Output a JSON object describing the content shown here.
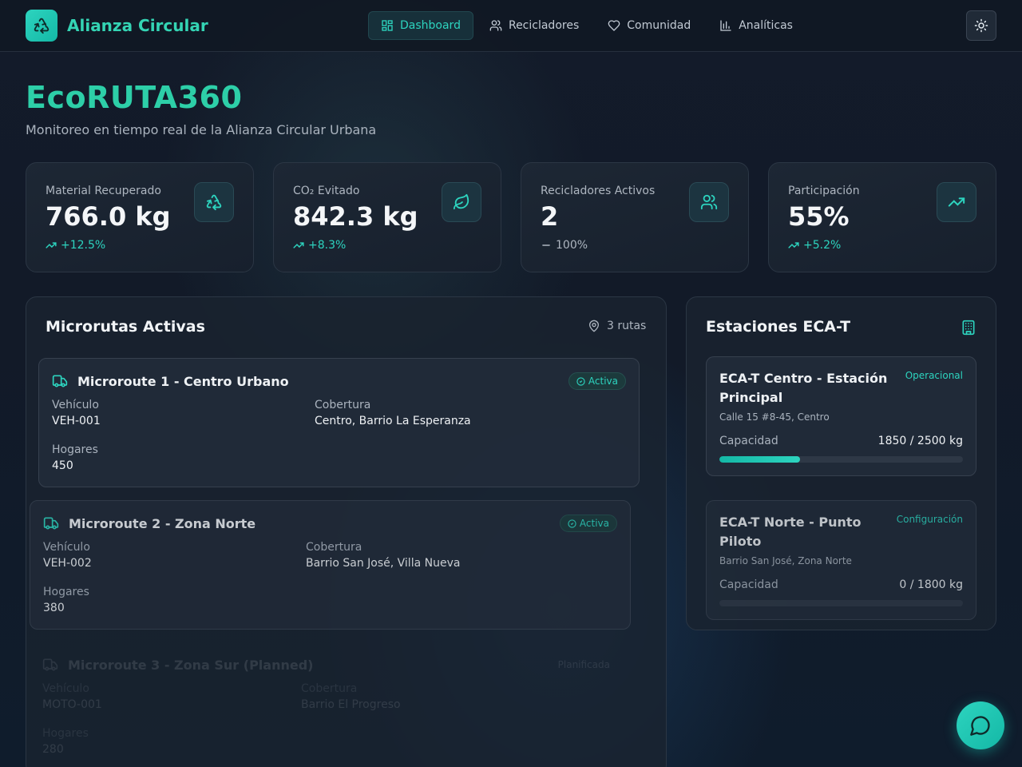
{
  "brand": {
    "name": "Alianza Circular",
    "logo_icon": "recycle-icon"
  },
  "nav": [
    {
      "label": "Dashboard",
      "icon": "dashboard-icon",
      "active": true
    },
    {
      "label": "Recicladores",
      "icon": "users-icon",
      "active": false
    },
    {
      "label": "Comunidad",
      "icon": "heart-icon",
      "active": false
    },
    {
      "label": "Analíticas",
      "icon": "bar-chart-icon",
      "active": false
    }
  ],
  "theme_toggle_icon": "sun-icon",
  "hero": {
    "title": "EcoRUTA360",
    "subtitle": "Monitoreo en tiempo real de la Alianza Circular Urbana"
  },
  "stats": [
    {
      "label": "Material Recuperado",
      "value": "766.0 kg",
      "trend": "+12.5%",
      "trend_icon": "trending-up-icon",
      "icon": "recycle-icon"
    },
    {
      "label": "CO₂ Evitado",
      "value": "842.3 kg",
      "trend": "+8.3%",
      "trend_icon": "trending-up-icon",
      "icon": "leaf-icon"
    },
    {
      "label": "Recicladores Activos",
      "value": "2",
      "trend": "100%",
      "trend_icon": "minus-icon",
      "icon": "users-icon"
    },
    {
      "label": "Participación",
      "value": "55%",
      "trend": "+5.2%",
      "trend_icon": "trending-up-icon",
      "icon": "trending-up-icon"
    }
  ],
  "routes_panel": {
    "title": "Microrutas Activas",
    "count_label": "3 rutas",
    "field_labels": {
      "vehicle": "Vehículo",
      "coverage": "Cobertura",
      "households": "Hogares"
    },
    "routes": [
      {
        "name": "Microroute 1 - Centro Urbano",
        "status": "Activa",
        "vehicle": "VEH-001",
        "coverage": "Centro, Barrio La Esperanza",
        "households": "450"
      },
      {
        "name": "Microroute 2 - Zona Norte",
        "status": "Activa",
        "vehicle": "VEH-002",
        "coverage": "Barrio San José, Villa Nueva",
        "households": "380"
      },
      {
        "name": "Microroute 3 - Zona Sur (Planned)",
        "status": "Planificada",
        "vehicle": "MOTO-001",
        "coverage": "Barrio El Progreso",
        "households": "280"
      }
    ]
  },
  "stations_panel": {
    "title": "Estaciones ECA-T",
    "icon": "building-icon",
    "capacity_label": "Capacidad",
    "stations": [
      {
        "name": "ECA-T Centro - Estación Principal",
        "status": "Operacional",
        "address": "Calle 15 #8-45, Centro",
        "capacity": "1850 / 2500 kg",
        "fill_fraction": 0.33
      },
      {
        "name": "ECA-T Norte - Punto Piloto",
        "status": "Configuración",
        "address": "Barrio San José, Zona Norte",
        "capacity": "0 / 1800 kg",
        "fill_fraction": 0
      }
    ]
  },
  "chat_icon": "chat-bubble-icon",
  "colors": {
    "accent": "#2dd4bf",
    "background": "#121a28",
    "card": "#1d2734"
  }
}
